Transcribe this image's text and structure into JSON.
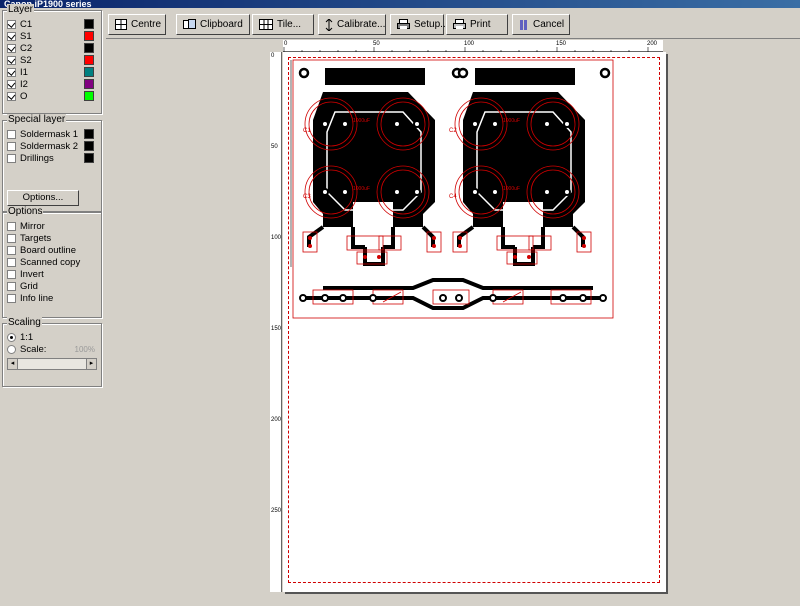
{
  "window": {
    "title": "Canon iP1900 series"
  },
  "toolbar": {
    "centre": "Centre",
    "clipboard": "Clipboard",
    "tile": "Tile...",
    "calibrate": "Calibrate...",
    "setup": "Setup...",
    "print": "Print",
    "cancel": "Cancel"
  },
  "layer": {
    "title": "Layer",
    "items": [
      {
        "label": "C1",
        "checked": true,
        "color": "#000000"
      },
      {
        "label": "S1",
        "checked": true,
        "color": "#ff0000"
      },
      {
        "label": "C2",
        "checked": true,
        "color": "#000000"
      },
      {
        "label": "S2",
        "checked": true,
        "color": "#ff0000"
      },
      {
        "label": "I1",
        "checked": true,
        "color": "#008080"
      },
      {
        "label": "I2",
        "checked": true,
        "color": "#800080"
      },
      {
        "label": "O",
        "checked": true,
        "color": "#00ff00"
      }
    ]
  },
  "special_layer": {
    "title": "Special layer",
    "items": [
      {
        "label": "Soldermask 1",
        "checked": false,
        "color": "#000000"
      },
      {
        "label": "Soldermask 2",
        "checked": false,
        "color": "#000000"
      },
      {
        "label": "Drillings",
        "checked": false,
        "color": "#000000"
      }
    ],
    "options_button": "Options..."
  },
  "options": {
    "title": "Options",
    "items": [
      {
        "label": "Mirror",
        "checked": false
      },
      {
        "label": "Targets",
        "checked": false
      },
      {
        "label": "Board outline",
        "checked": false
      },
      {
        "label": "Scanned copy",
        "checked": false
      },
      {
        "label": "Invert",
        "checked": false
      },
      {
        "label": "Grid",
        "checked": false
      },
      {
        "label": "Info line",
        "checked": false
      }
    ]
  },
  "scaling": {
    "title": "Scaling",
    "one_to_one": "1:1",
    "scale_label": "Scale:",
    "scale_value": "100%"
  },
  "ruler": {
    "h_labels": [
      "0",
      "50",
      "100",
      "150",
      "200"
    ],
    "v_labels": [
      "0",
      "50",
      "100",
      "150",
      "200",
      "250"
    ]
  },
  "pcb": {
    "cap_labels": [
      "C1",
      "C2",
      "C3",
      "C4"
    ],
    "cap_value": "1000uF"
  }
}
